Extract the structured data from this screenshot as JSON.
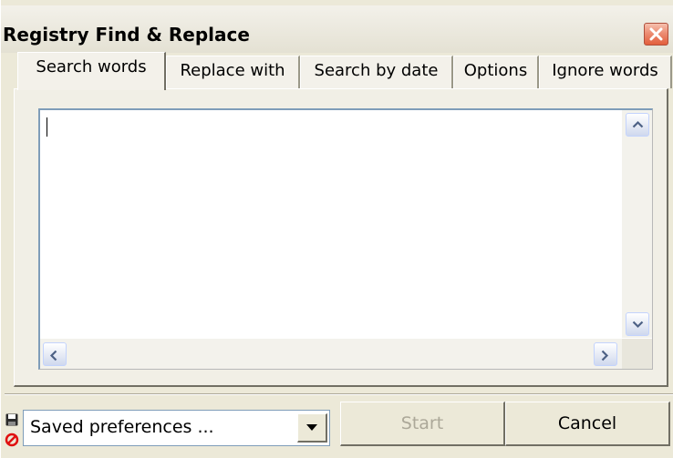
{
  "window": {
    "title": "Registry Find & Replace"
  },
  "tabs": [
    {
      "label": "Search words",
      "active": true
    },
    {
      "label": "Replace with",
      "active": false
    },
    {
      "label": "Search by date",
      "active": false
    },
    {
      "label": "Options",
      "active": false
    },
    {
      "label": "Ignore words",
      "active": false
    }
  ],
  "search_words": {
    "text": ""
  },
  "footer": {
    "preferences_selected": "Saved preferences ...",
    "start_label": "Start",
    "start_enabled": false,
    "cancel_label": "Cancel"
  },
  "icons": {
    "close": "close-icon",
    "save": "floppy-disk-icon",
    "delete": "no-entry-icon",
    "dropdown": "chevron-down-icon",
    "scroll_up": "arrow-up-icon",
    "scroll_down": "arrow-down-icon",
    "scroll_left": "arrow-left-icon",
    "scroll_right": "arrow-right-icon"
  },
  "colors": {
    "window_bg": "#ece9d8",
    "close_button": "#e35e3c",
    "input_border": "#7f9db9",
    "disabled_text": "#aca899"
  }
}
